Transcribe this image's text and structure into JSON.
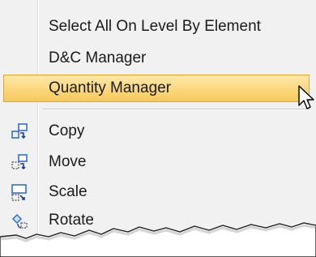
{
  "menu": {
    "items": [
      {
        "label": "Select All On Level By Element",
        "icon": ""
      },
      {
        "label": "D&C Manager",
        "icon": ""
      },
      {
        "label": "Quantity Manager",
        "icon": "",
        "highlighted": true
      },
      {
        "label": "Copy",
        "icon": "copy-icon"
      },
      {
        "label": "Move",
        "icon": "move-icon"
      },
      {
        "label": "Scale",
        "icon": "scale-icon"
      },
      {
        "label": "Rotate",
        "icon": "rotate-icon"
      }
    ],
    "highlight_color": "#f7c95a",
    "icon_color": "#2f6fd6"
  }
}
